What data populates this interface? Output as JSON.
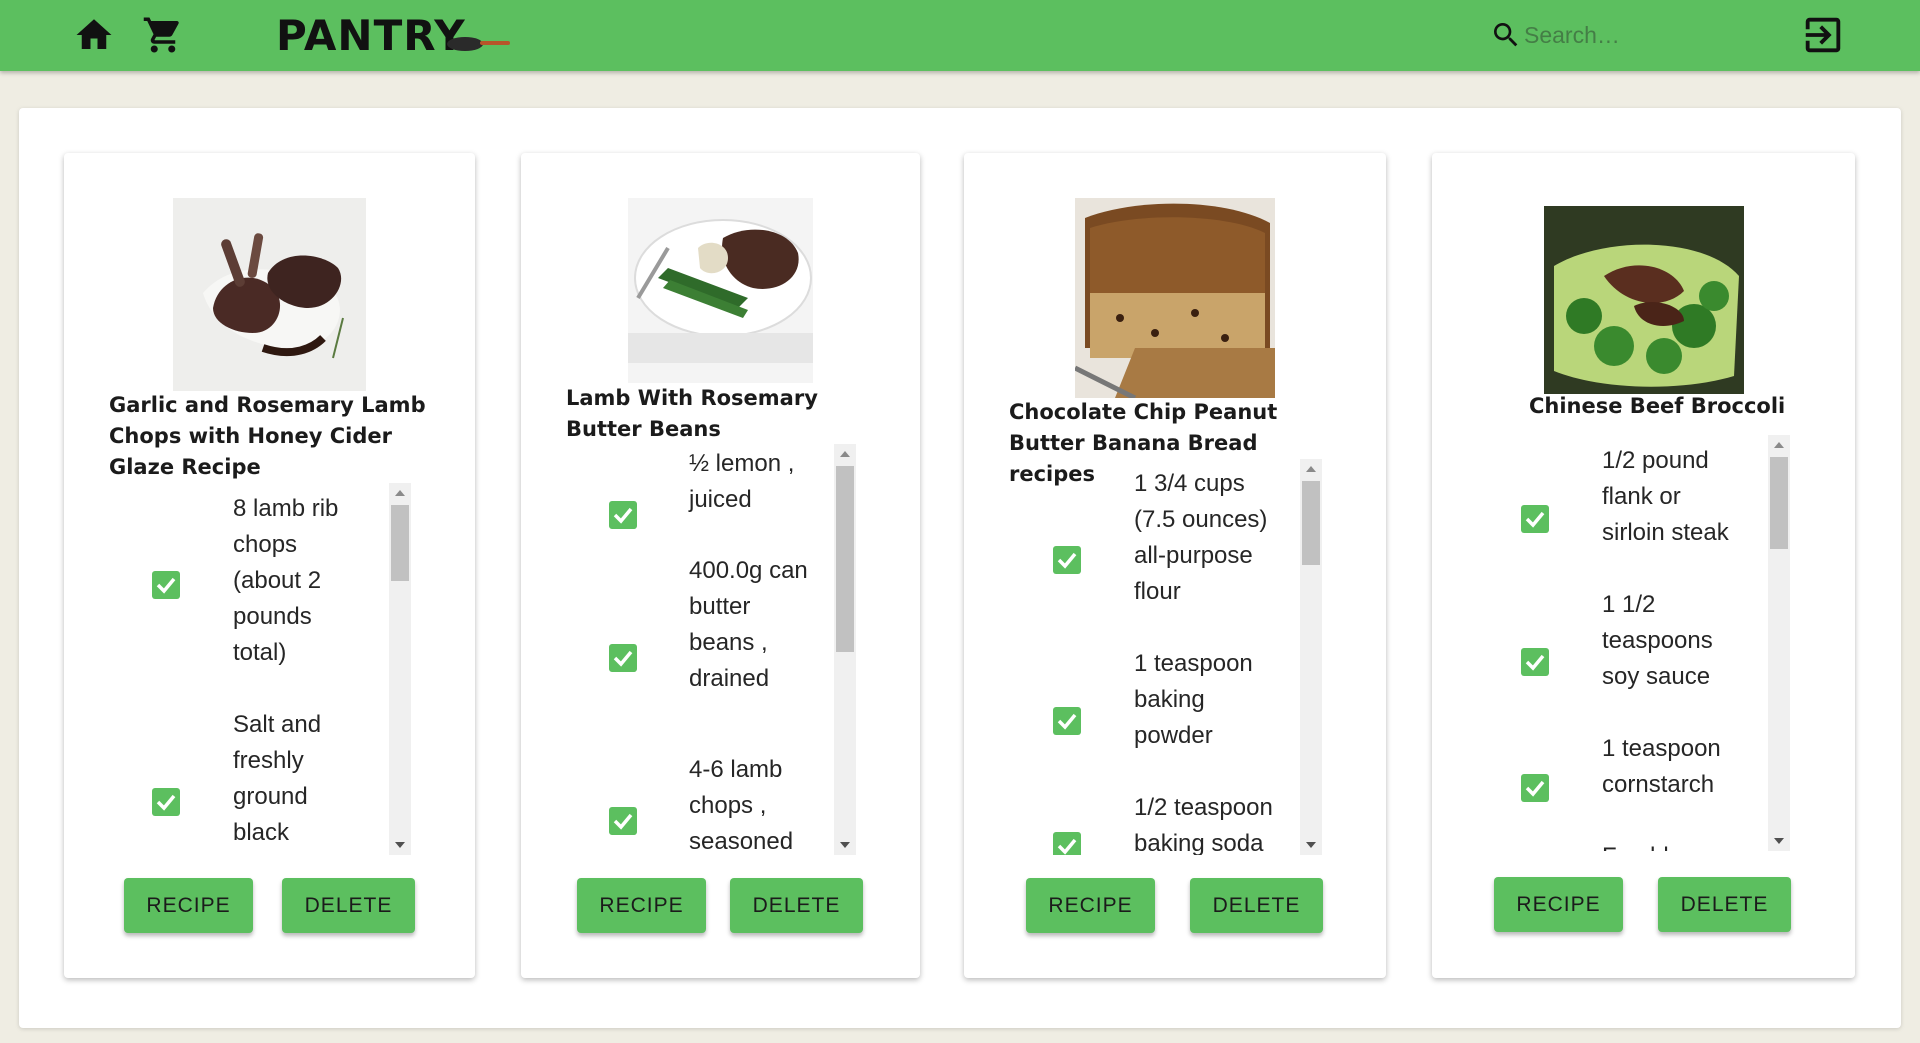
{
  "header": {
    "brand": "PANTRY",
    "search_placeholder": "Search…"
  },
  "colors": {
    "primary": "#5cbf5f",
    "background": "#efede3"
  },
  "icons": [
    "home-icon",
    "cart-icon",
    "frying-pan-icon",
    "search-icon",
    "logout-icon",
    "checkbox-checked-icon"
  ],
  "recipes": [
    {
      "title": "Garlic and Rosemary Lamb Chops with Honey Cider Glaze Recipe",
      "ingredients": [
        "8 lamb rib chops (about 2 pounds total)",
        "Salt and freshly ground black"
      ],
      "checked": [
        true,
        true
      ],
      "recipe_label": "RECIPE",
      "delete_label": "DELETE"
    },
    {
      "title": "Lamb With Rosemary Butter Beans",
      "ingredients": [
        "½ lemon , juiced",
        "400.0g can butter beans , drained",
        "4-6 lamb chops , seasoned"
      ],
      "checked": [
        true,
        true,
        true
      ],
      "recipe_label": "RECIPE",
      "delete_label": "DELETE"
    },
    {
      "title": "Chocolate Chip Peanut Butter Banana Bread recipes",
      "ingredients": [
        "1 3/4 cups (7.5 ounces) all-purpose flour",
        "1 teaspoon baking powder",
        "1/2 teaspoon baking soda"
      ],
      "checked": [
        true,
        true,
        true
      ],
      "recipe_label": "RECIPE",
      "delete_label": "DELETE"
    },
    {
      "title": "Chinese Beef Broccoli",
      "ingredients": [
        "1/2 pound flank or sirloin steak",
        "1 1/2 teaspoons soy sauce",
        "1 teaspoon cornstarch",
        "Freshly"
      ],
      "checked": [
        true,
        true,
        true,
        false
      ],
      "recipe_label": "RECIPE",
      "delete_label": "DELETE"
    }
  ]
}
